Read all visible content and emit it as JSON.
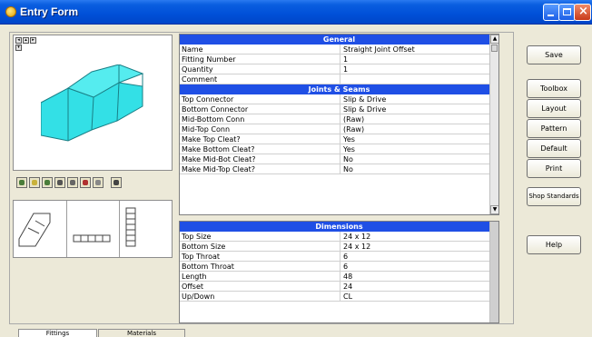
{
  "window": {
    "title": "Entry Form"
  },
  "general": {
    "header": "General",
    "rows": [
      {
        "label": "Name",
        "value": "Straight Joint Offset"
      },
      {
        "label": "Fitting Number",
        "value": "1"
      },
      {
        "label": "Quantity",
        "value": "1"
      },
      {
        "label": "Comment",
        "value": ""
      }
    ]
  },
  "joints": {
    "header": "Joints & Seams",
    "rows": [
      {
        "label": "Top Connector",
        "value": "Slip & Drive"
      },
      {
        "label": "Bottom Connector",
        "value": "Slip & Drive"
      },
      {
        "label": "Mid-Bottom Conn",
        "value": "(Raw)"
      },
      {
        "label": "Mid-Top Conn",
        "value": "(Raw)"
      },
      {
        "label": "Make Top Cleat?",
        "value": "Yes"
      },
      {
        "label": "Make Bottom Cleat?",
        "value": "Yes"
      },
      {
        "label": "Make Mid-Bot Cleat?",
        "value": "No"
      },
      {
        "label": "Make Mid-Top Cleat?",
        "value": "No"
      }
    ]
  },
  "dimensions": {
    "header": "Dimensions",
    "rows": [
      {
        "label": "Top Size",
        "value": "24 x 12"
      },
      {
        "label": "Bottom Size",
        "value": "24 x 12"
      },
      {
        "label": "Top Throat",
        "value": "6"
      },
      {
        "label": "Bottom Throat",
        "value": "6"
      },
      {
        "label": "Length",
        "value": "48"
      },
      {
        "label": "Offset",
        "value": "24"
      },
      {
        "label": "Up/Down",
        "value": "CL"
      }
    ]
  },
  "buttons": {
    "save": "Save",
    "toolbox": "Toolbox",
    "layout": "Layout",
    "pattern": "Pattern",
    "default": "Default",
    "print": "Print",
    "shop_standards": "Shop Standards",
    "help": "Help"
  },
  "tabs": {
    "fittings": "Fittings",
    "materials": "Materials"
  },
  "icons": {
    "toolbar": [
      "shade-icon",
      "wireframe-icon",
      "iso-view-icon",
      "front-view-icon",
      "side-view-icon",
      "zoom-icon",
      "grid-icon",
      "settings-icon"
    ]
  },
  "colors": {
    "title_bar": "#0050d8",
    "section_header": "#1f4fe5",
    "model_fill": "#33e0e6"
  }
}
